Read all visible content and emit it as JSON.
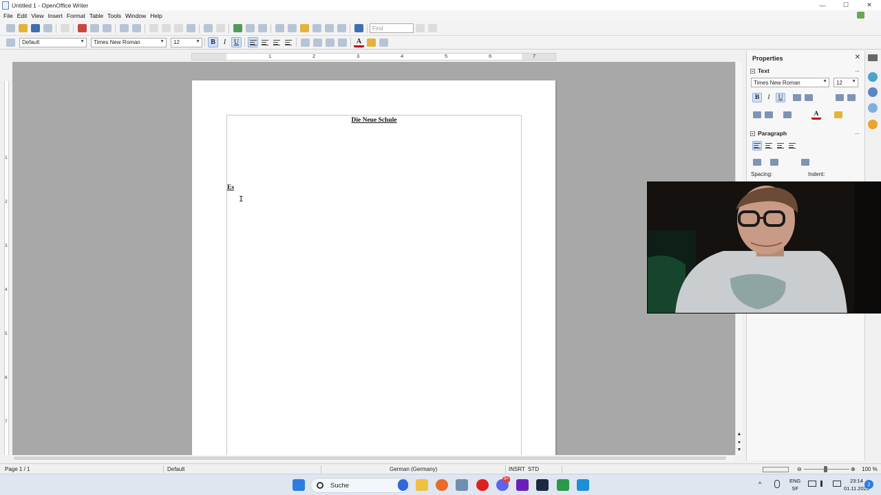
{
  "window": {
    "title": "Untitled 1 - OpenOffice Writer",
    "controls": {
      "minimize": "—",
      "maximize": "☐",
      "close": "✕"
    }
  },
  "menu": [
    "File",
    "Edit",
    "View",
    "Insert",
    "Format",
    "Table",
    "Tools",
    "Window",
    "Help"
  ],
  "toolbar": {
    "find_placeholder": "Find"
  },
  "formatting": {
    "paragraph_style": "Default",
    "font_name": "Times New Roman",
    "font_size": "12",
    "bold_label": "B",
    "italic_label": "I",
    "underline_label": "U",
    "font_color_label": "A"
  },
  "ruler": {
    "h_numbers": [
      "1",
      "2",
      "3",
      "4",
      "5",
      "6",
      "7"
    ],
    "v_numbers": [
      "1",
      "2",
      "3",
      "4",
      "5",
      "6",
      "7"
    ]
  },
  "document": {
    "heading": "Die Neue Schule",
    "body_line": "Es"
  },
  "sidebar": {
    "title": "Properties",
    "close": "✕",
    "text_section": "Text",
    "font_name": "Times New Roman",
    "font_size": "12",
    "paragraph_section": "Paragraph",
    "spacing_label": "Spacing:",
    "indent_label": "Indent:",
    "more": "···"
  },
  "status": {
    "page": "Page 1 / 1",
    "page_style": "Default",
    "language": "German (Germany)",
    "insert_mode": "INSRT",
    "selection_mode": "STD",
    "zoom": "100 %"
  },
  "taskbar": {
    "search_label": "Suche",
    "discord_badge": "9+",
    "lang_top": "ENG",
    "lang_bottom": "SF",
    "time": "23:14",
    "date": "01.11.2023",
    "notification_count": "2"
  },
  "colors": {
    "accent": "#3f6fb0",
    "doc_background": "#a8a8a8",
    "active_button": "#d0e0f5",
    "taskbar": "#dfe6ef"
  }
}
